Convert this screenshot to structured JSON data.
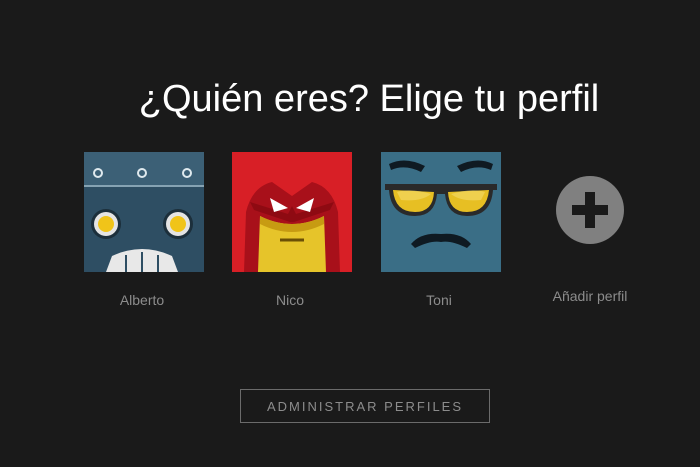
{
  "header": {
    "title": "¿Quién eres? Elige tu perfil"
  },
  "profiles": [
    {
      "name": "Alberto",
      "avatar_icon": "robot-icon"
    },
    {
      "name": "Nico",
      "avatar_icon": "red-helmet-icon"
    },
    {
      "name": "Toni",
      "avatar_icon": "sunglasses-face-icon"
    }
  ],
  "add_profile": {
    "label": "Añadir perfil",
    "icon": "plus-circle-icon"
  },
  "manage_button": {
    "label": "ADMINISTRAR PERFILES"
  },
  "colors": {
    "background": "#1a1a1a",
    "muted_text": "#8c8c8c",
    "title_text": "#ffffff"
  }
}
